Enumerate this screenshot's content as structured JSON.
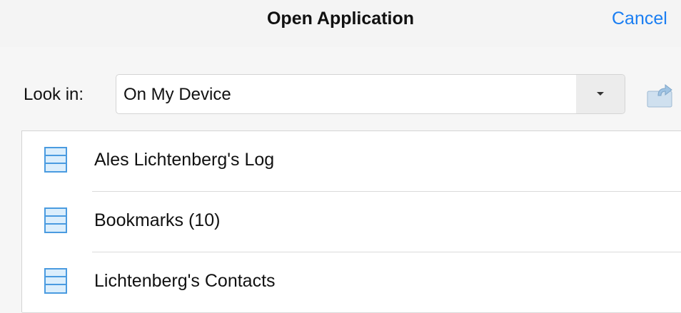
{
  "dialog": {
    "title": "Open Application",
    "cancel_label": "Cancel"
  },
  "look_in": {
    "label": "Look in:",
    "selected": "On My Device",
    "dropdown_icon": "chevron-down-icon",
    "up_icon": "folder-up-icon"
  },
  "files": [
    {
      "name": "Ales Lichtenberg's Log",
      "icon": "database-file-icon"
    },
    {
      "name": "Bookmarks (10)",
      "icon": "database-file-icon"
    },
    {
      "name": "Lichtenberg's Contacts",
      "icon": "database-file-icon"
    }
  ],
  "colors": {
    "accent": "#1a7ef2",
    "icon_blue": "#4a9be0"
  }
}
